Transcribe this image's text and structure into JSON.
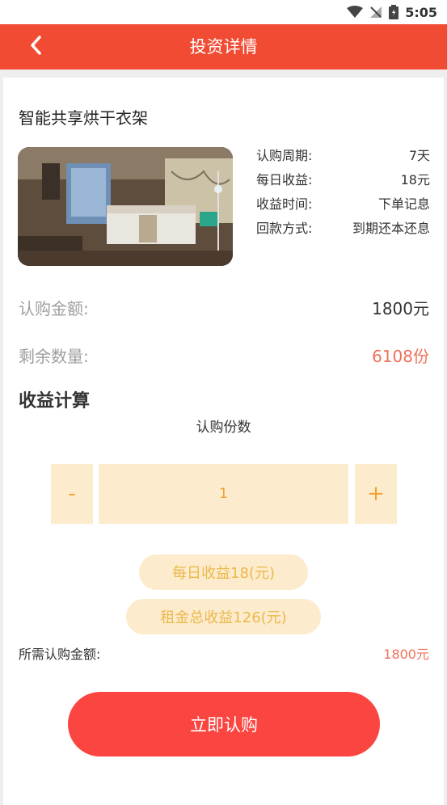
{
  "status_bar": {
    "time": "5:05",
    "icons": [
      "wifi-icon",
      "no-signal-icon",
      "battery-icon"
    ]
  },
  "app_bar": {
    "title": "投资详情",
    "back_icon": "chevron-left-icon"
  },
  "product": {
    "name": "智能共享烘干衣架",
    "info": [
      {
        "label": "认购周期:",
        "value": "7天"
      },
      {
        "label": "每日收益:",
        "value": "18元"
      },
      {
        "label": "收益时间:",
        "value": "下单记息"
      },
      {
        "label": "回款方式:",
        "value": "到期还本还息"
      }
    ]
  },
  "subscription_amount": {
    "label": "认购金额:",
    "value": "1800元"
  },
  "remaining": {
    "label": "剩余数量:",
    "value": "6108份"
  },
  "calc": {
    "title": "收益计算",
    "copies_label": "认购份数",
    "minus": "-",
    "plus": "+",
    "quantity": "1",
    "daily_income": "每日收益18(元)",
    "total_income": "租金总收益126(元)",
    "required_label": "所需认购金额:",
    "required_value": "1800元"
  },
  "buy_button": "立即认购",
  "colors": {
    "primary": "#f14c33",
    "button": "#fb4541",
    "accent_orange": "#f0a233",
    "pill_bg": "#fcebcc",
    "highlight_red": "#f0705a"
  }
}
